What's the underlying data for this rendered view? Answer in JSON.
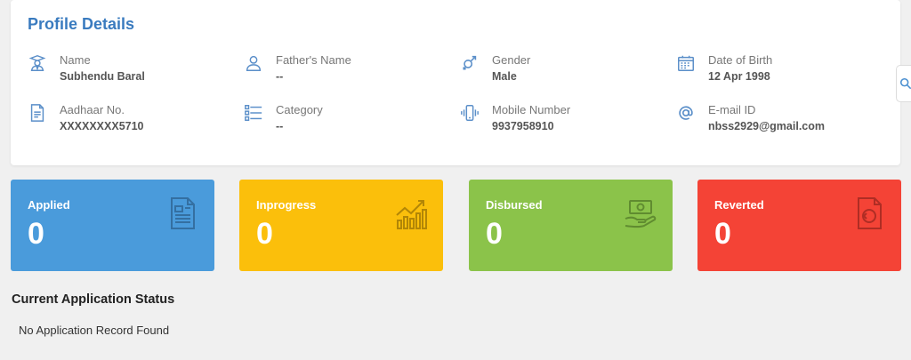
{
  "profile": {
    "title": "Profile Details",
    "fields": [
      {
        "icon": "graduate-user-icon",
        "label": "Name",
        "value": "Subhendu Baral"
      },
      {
        "icon": "person-icon",
        "label": "Father's Name",
        "value": "--"
      },
      {
        "icon": "gender-icon",
        "label": "Gender",
        "value": "Male"
      },
      {
        "icon": "calendar-icon",
        "label": "Date of Birth",
        "value": "12 Apr 1998"
      },
      {
        "icon": "document-icon",
        "label": "Aadhaar No.",
        "value": "XXXXXXXX5710"
      },
      {
        "icon": "list-icon",
        "label": "Category",
        "value": "--"
      },
      {
        "icon": "mobile-vibrate-icon",
        "label": "Mobile Number",
        "value": "9937958910"
      },
      {
        "icon": "at-icon",
        "label": "E-mail ID",
        "value": "nbss2929@gmail.com"
      }
    ]
  },
  "side_tab": {
    "icon": "search-icon"
  },
  "stats": [
    {
      "label": "Applied",
      "count": "0",
      "color": "#4a9bdb",
      "icon": "document-icon"
    },
    {
      "label": "Inprogress",
      "count": "0",
      "color": "#fbbf0b",
      "icon": "growth-chart-icon"
    },
    {
      "label": "Disbursed",
      "count": "0",
      "color": "#8bc34a",
      "icon": "money-hand-icon"
    },
    {
      "label": "Reverted",
      "count": "0",
      "color": "#f44336",
      "icon": "revert-document-icon"
    }
  ],
  "status": {
    "title": "Current Application Status",
    "empty_message": "No Application Record Found"
  },
  "colors": {
    "accent": "#3a7bbf",
    "icon": "#5b8fc9"
  }
}
